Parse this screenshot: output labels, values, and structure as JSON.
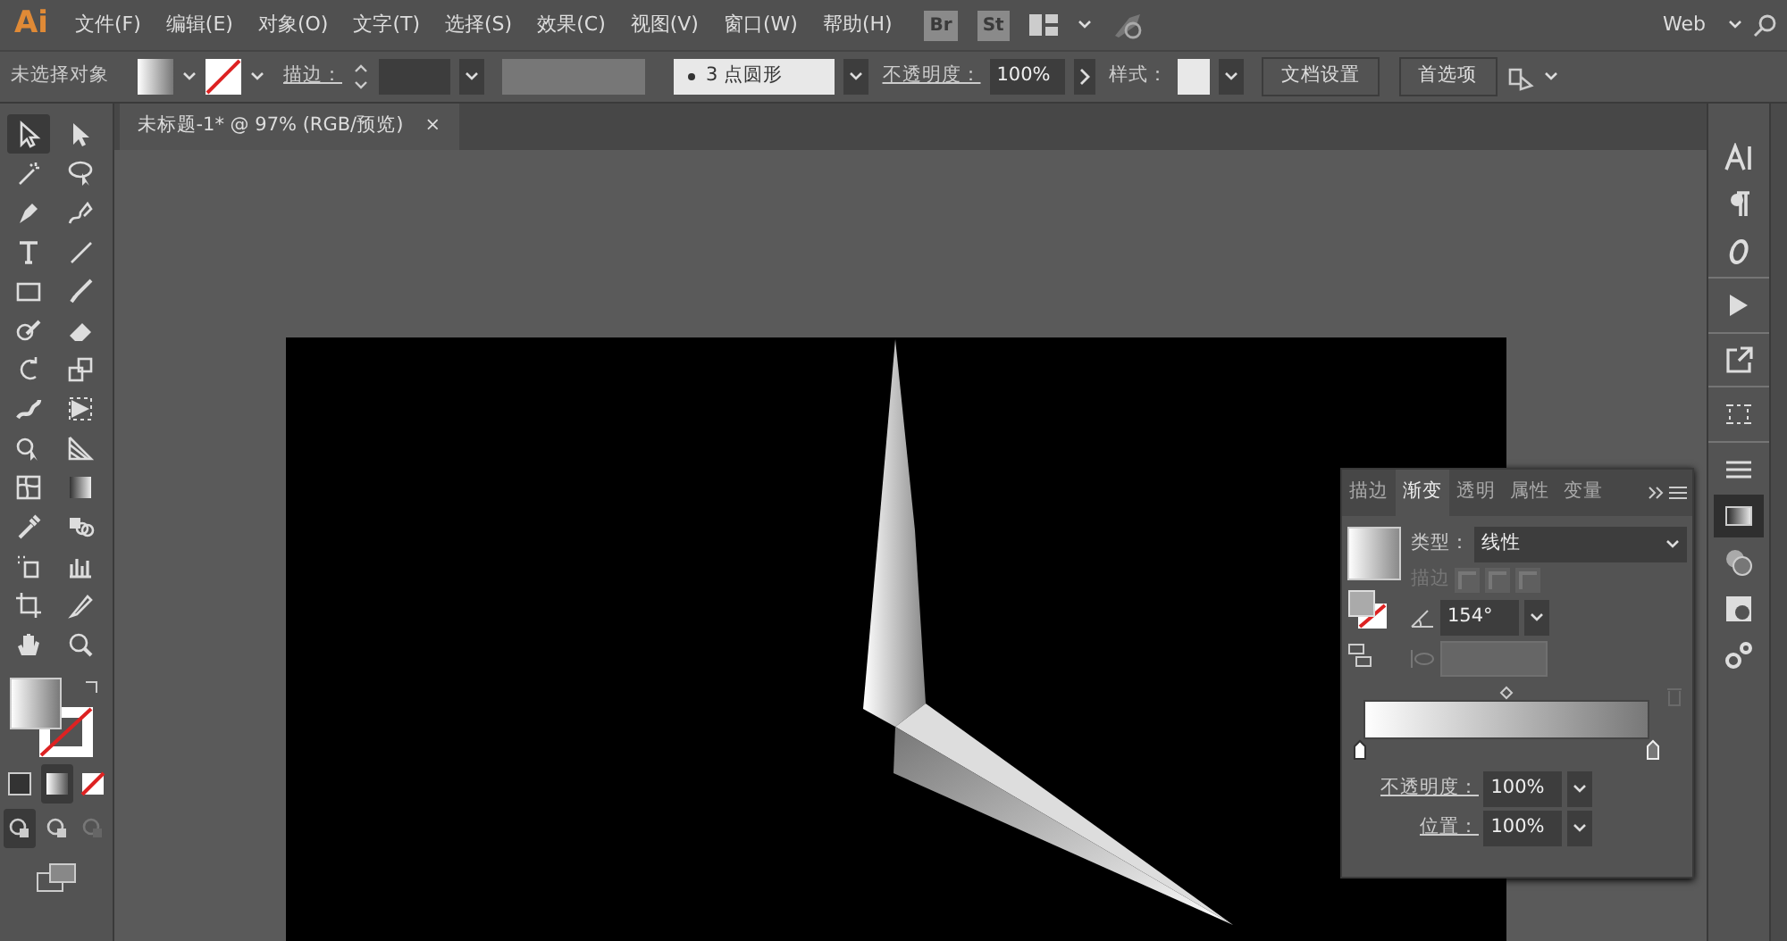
{
  "app": {
    "logo": "Ai"
  },
  "menu": [
    "文件(F)",
    "编辑(E)",
    "对象(O)",
    "文字(T)",
    "选择(S)",
    "效果(C)",
    "视图(V)",
    "窗口(W)",
    "帮助(H)"
  ],
  "bridge_buttons": [
    "Br",
    "St"
  ],
  "workspace": "Web",
  "control_bar": {
    "selection": "未选择对象",
    "stroke_label": "描边：",
    "brush": "3 点圆形",
    "opacity_label": "不透明度：",
    "opacity": "100%",
    "style_label": "样式：",
    "buttons": [
      "文档设置",
      "首选项"
    ]
  },
  "document_tab": {
    "title": "未标题-1* @ 97% (RGB/预览)",
    "close": "×"
  },
  "tools": [
    {
      "selected": true
    },
    {
      "selected": false
    },
    {
      "selected": false
    },
    {
      "selected": false
    },
    {
      "selected": false
    },
    {
      "selected": false
    },
    {
      "selected": false
    },
    {
      "selected": false
    },
    {
      "selected": false
    },
    {
      "selected": false
    },
    {
      "selected": false
    },
    {
      "selected": false
    },
    {
      "selected": false
    },
    {
      "selected": false
    },
    {
      "selected": false
    },
    {
      "selected": false
    },
    {
      "selected": false
    },
    {
      "selected": false
    },
    {
      "selected": false
    },
    {
      "selected": false
    },
    {
      "selected": false
    },
    {
      "selected": false
    },
    {
      "selected": false
    },
    {
      "selected": false
    },
    {
      "selected": false
    },
    {
      "selected": false
    },
    {
      "selected": false
    },
    {
      "selected": false
    }
  ],
  "fill_modes": [
    {
      "selected": false
    },
    {
      "selected": true
    },
    {
      "selected": false
    }
  ],
  "draw_modes": [
    {
      "selected": true
    },
    {
      "selected": false
    },
    {
      "selected": false
    }
  ],
  "dock_icons": [
    {
      "selected": false
    },
    {
      "selected": false
    },
    {
      "selected": false
    },
    {
      "selected": false
    },
    {
      "selected": false
    },
    {
      "selected": false
    },
    {
      "selected": false
    },
    {
      "selected": true
    },
    {
      "selected": false
    },
    {
      "selected": false
    },
    {
      "selected": false
    }
  ],
  "gradient_panel": {
    "tabs": [
      {
        "label": "描边",
        "selected": false
      },
      {
        "label": "渐变",
        "selected": true
      },
      {
        "label": "透明",
        "selected": false
      },
      {
        "label": "属性",
        "selected": false
      },
      {
        "label": "变量",
        "selected": false
      }
    ],
    "type_label": "类型：",
    "type": "线性",
    "stroke_label": "描边",
    "angle": "154°",
    "opacity_label": "不透明度：",
    "opacity": "100%",
    "location_label": "位置：",
    "location": "100%"
  }
}
